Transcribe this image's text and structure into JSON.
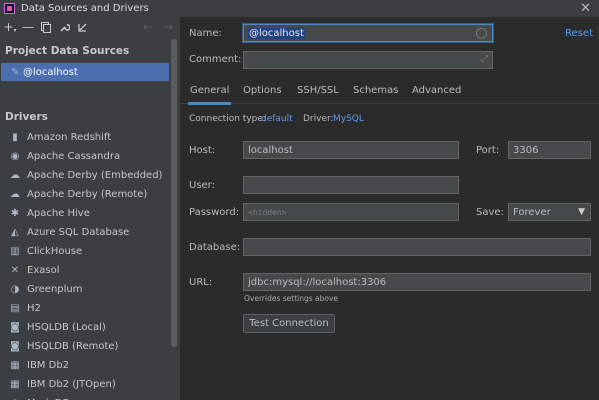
{
  "window": {
    "title": "Data Sources and Drivers"
  },
  "left": {
    "project_header": "Project Data Sources",
    "selected_source": "@localhost",
    "drivers_header": "Drivers",
    "drivers": [
      {
        "label": "Amazon Redshift",
        "icon": "redshift-icon",
        "glyph": "▮"
      },
      {
        "label": "Apache Cassandra",
        "icon": "cassandra-icon",
        "glyph": "◉"
      },
      {
        "label": "Apache Derby (Embedded)",
        "icon": "derby-icon",
        "glyph": "☁"
      },
      {
        "label": "Apache Derby (Remote)",
        "icon": "derby-icon",
        "glyph": "☁"
      },
      {
        "label": "Apache Hive",
        "icon": "hive-icon",
        "glyph": "✱"
      },
      {
        "label": "Azure SQL Database",
        "icon": "azure-icon",
        "glyph": "◭"
      },
      {
        "label": "ClickHouse",
        "icon": "clickhouse-icon",
        "glyph": "▥"
      },
      {
        "label": "Exasol",
        "icon": "exasol-icon",
        "glyph": "✕"
      },
      {
        "label": "Greenplum",
        "icon": "greenplum-icon",
        "glyph": "◑"
      },
      {
        "label": "H2",
        "icon": "h2-icon",
        "glyph": "▤"
      },
      {
        "label": "HSQLDB (Local)",
        "icon": "hsqldb-icon",
        "glyph": "◙"
      },
      {
        "label": "HSQLDB (Remote)",
        "icon": "hsqldb-icon",
        "glyph": "◙"
      },
      {
        "label": "IBM Db2",
        "icon": "ibm-icon",
        "glyph": "▦"
      },
      {
        "label": "IBM Db2 (JTOpen)",
        "icon": "ibm-icon",
        "glyph": "▦"
      },
      {
        "label": "MariaDB",
        "icon": "mariadb-icon",
        "glyph": "◓"
      }
    ]
  },
  "form": {
    "name_label": "Name:",
    "name_value": "@localhost",
    "reset": "Reset",
    "comment_label": "Comment:",
    "comment_value": "",
    "tabs": [
      "General",
      "Options",
      "SSH/SSL",
      "Schemas",
      "Advanced"
    ],
    "conn_type_label": "Connection type:",
    "conn_type_value": "default",
    "driver_label": "Driver:",
    "driver_value": "MySQL",
    "host_label": "Host:",
    "host_value": "localhost",
    "port_label": "Port:",
    "port_value": "3306",
    "user_label": "User:",
    "user_value": "",
    "password_label": "Password:",
    "password_placeholder": "<hidden>",
    "save_label": "Save:",
    "save_value": "Forever",
    "database_label": "Database:",
    "database_value": "",
    "url_label": "URL:",
    "url_value": "jdbc:mysql://localhost:3306",
    "url_hint": "Overrides settings above",
    "test_button": "Test Connection"
  },
  "colors": {
    "accent": "#4b6eaf",
    "link": "#589df6",
    "bg": "#2b2b2b",
    "panel": "#3c3f41"
  }
}
